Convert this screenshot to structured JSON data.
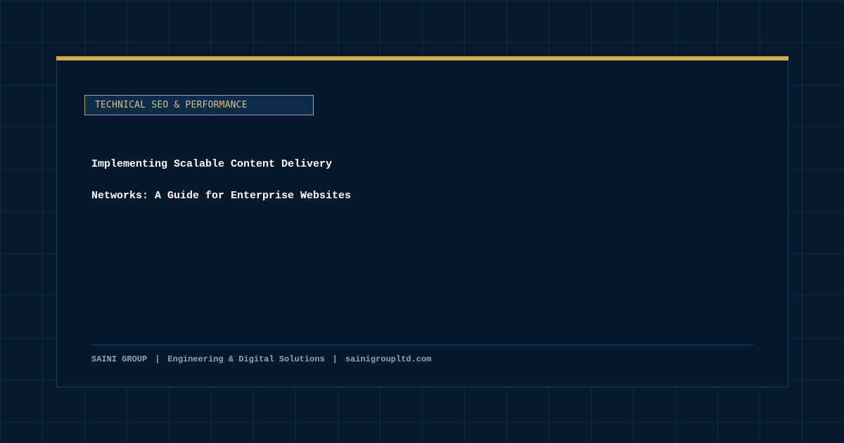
{
  "theme": {
    "accent": "#d4aa4a",
    "badge_text": "#d9c27a",
    "background": "#071a2e"
  },
  "category_badge": "TECHNICAL SEO & PERFORMANCE",
  "title_lines": [
    "Implementing Scalable Content Delivery",
    "Networks: A Guide for Enterprise Websites"
  ],
  "footer": {
    "company": "SAINI GROUP",
    "separator": "|",
    "tagline": "Engineering & Digital Solutions",
    "website": "sainigroupltd.com"
  }
}
